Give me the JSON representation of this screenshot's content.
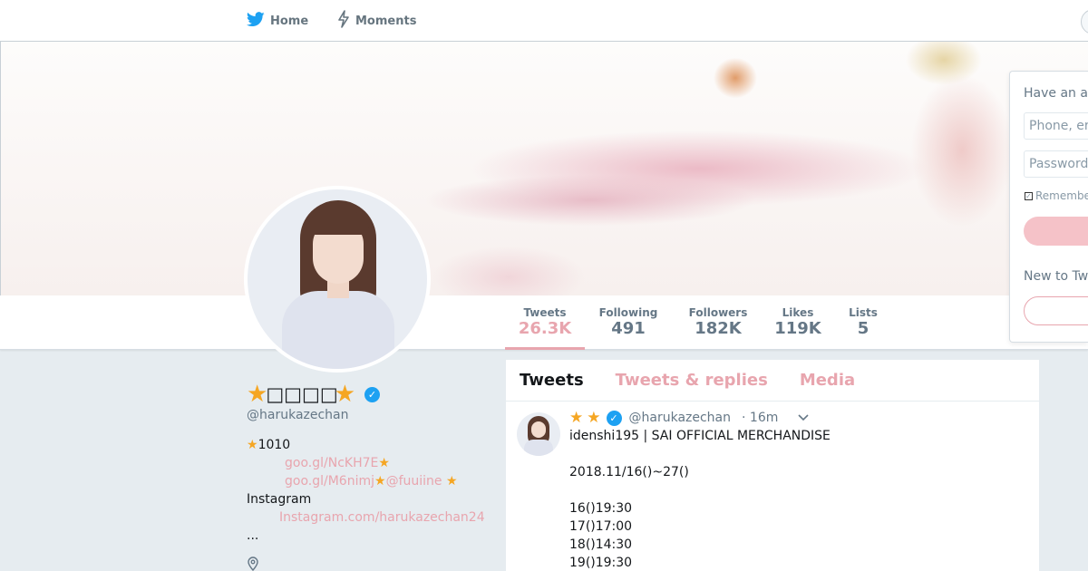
{
  "nav": {
    "home_label": "Home",
    "moments_label": "Moments"
  },
  "stats": [
    {
      "label": "Tweets",
      "value": "26.3K"
    },
    {
      "label": "Following",
      "value": "491"
    },
    {
      "label": "Followers",
      "value": "182K"
    },
    {
      "label": "Likes",
      "value": "119K"
    },
    {
      "label": "Lists",
      "value": "5"
    }
  ],
  "profile": {
    "name": "□□□□",
    "handle": "@harukazechan",
    "bio": {
      "line1": "1010",
      "link1": "goo.gl/NcKH7E",
      "link2": "goo.gl/M6nimj",
      "mention": "@fuuiine",
      "line4": "Instagram",
      "link3": "Instagram.com/harukazechan24",
      "line6": "..."
    }
  },
  "timeline": {
    "tabs": [
      "Tweets",
      "Tweets & replies",
      "Media"
    ],
    "tweet": {
      "handle": "@harukazechan",
      "time": "· 16m",
      "lines": [
        "idenshi195 | SAI OFFICIAL MERCHANDISE",
        "",
        "2018.11/16()~27()",
        "",
        "16()19:30",
        "17()17:00",
        "18()14:30",
        "19()19:30"
      ]
    }
  },
  "login": {
    "prompt": "Have an a",
    "phone_placeholder": "Phone, er",
    "password_placeholder": "Password",
    "remember_label": "Remembe",
    "new_prompt": "New to Tw"
  },
  "colors": {
    "accent": "#e8a5ae",
    "twitter_blue": "#1da1f2",
    "star": "#f5a623",
    "page_bg": "#e6ecf0"
  },
  "icons": [
    "twitter-bird-icon",
    "lightning-icon",
    "star-icon",
    "verified-badge-icon",
    "chevron-down-icon",
    "location-pin-icon"
  ]
}
